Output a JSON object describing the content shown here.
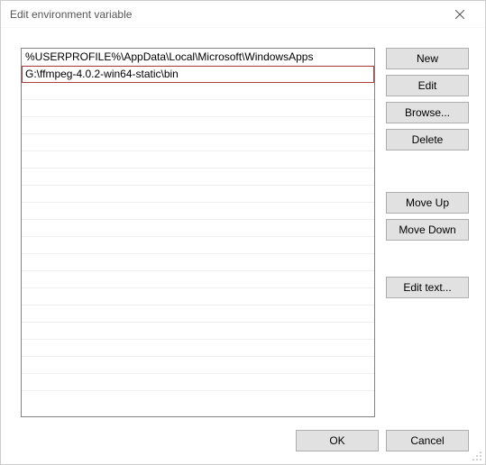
{
  "window": {
    "title": "Edit environment variable"
  },
  "list": {
    "entries": [
      "%USERPROFILE%\\AppData\\Local\\Microsoft\\WindowsApps",
      "G:\\ffmpeg-4.0.2-win64-static\\bin"
    ],
    "highlighted_index": 1
  },
  "buttons": {
    "new": "New",
    "edit": "Edit",
    "browse": "Browse...",
    "delete": "Delete",
    "move_up": "Move Up",
    "move_down": "Move Down",
    "edit_text": "Edit text...",
    "ok": "OK",
    "cancel": "Cancel"
  }
}
